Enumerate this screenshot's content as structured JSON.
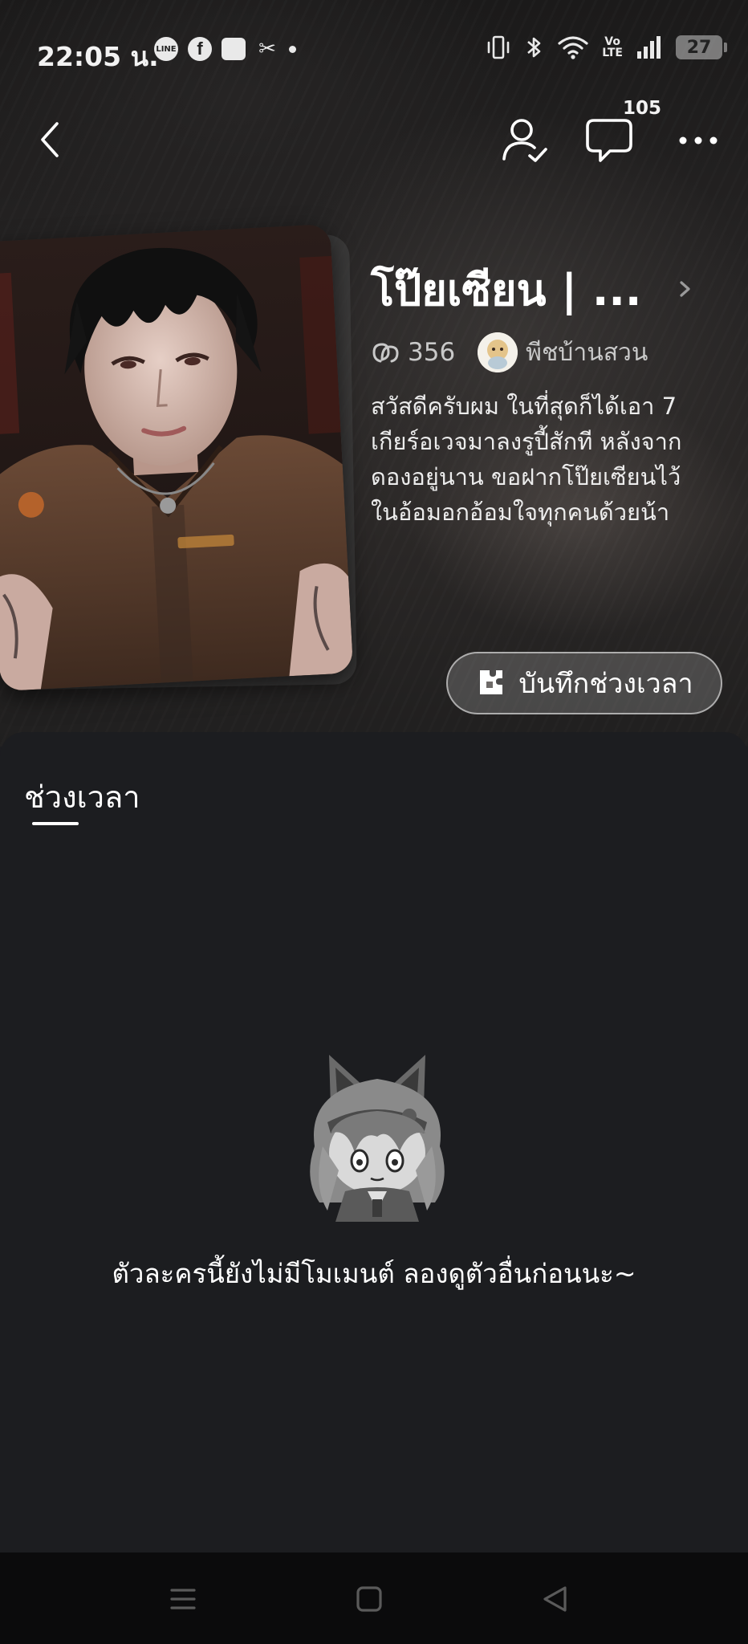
{
  "status_bar": {
    "time": "22:05 น.",
    "apps": [
      "line-icon",
      "facebook-icon",
      "news-icon",
      "capcut-icon"
    ],
    "battery": "27",
    "network_badge_top": "Vo",
    "network_badge_bottom": "LTE"
  },
  "nav": {
    "comment_count": "105"
  },
  "character": {
    "name": "โป๊ยเซียน | ...",
    "chat_count": "356",
    "creator_name": "พีชบ้านสวน",
    "description_lines": [
      "สวัสดีครับผม ในที่สุดก็ได้เอา 7",
      "เกียร์อเวจมาลงรูปี้สักที หลังจาก",
      "ดองอยู่นาน ขอฝากโป๊ยเซียนไว้",
      "ในอ้อมอกอ้อมใจทุกคนด้วยน้า"
    ],
    "record_button_label": "บันทึกช่วงเวลา"
  },
  "tabs": {
    "active_label": "ช่วงเวลา"
  },
  "empty_state": {
    "message": "ตัวละครนี้ยังไม่มีโมเมนต์ ลองดูตัวอื่นก่อนนะ~"
  },
  "colors": {
    "sheet_background": "#1c1d20",
    "system_nav_background": "#0b0b0c",
    "text_primary": "#ffffff",
    "text_secondary": "#c9c9c9"
  }
}
